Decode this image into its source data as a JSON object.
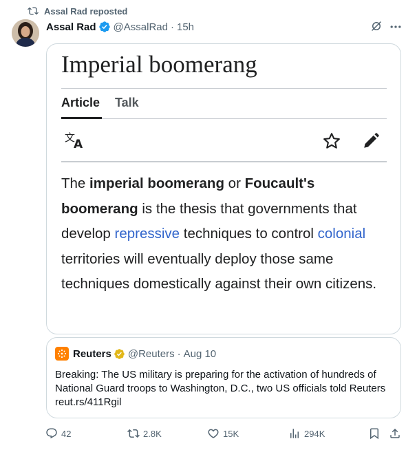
{
  "repost": {
    "label": "Assal Rad reposted"
  },
  "post": {
    "author_name": "Assal Rad",
    "handle": "@AssalRad",
    "separator": "·",
    "time": "15h"
  },
  "media": {
    "title": "Imperial boomerang",
    "tabs": [
      "Article",
      "Talk"
    ],
    "body": {
      "p1": "The ",
      "b1": "imperial boomerang",
      "p2": " or ",
      "b2": "Foucault's boomerang",
      "p3": " is the thesis that governments that develop ",
      "l1": "repressive",
      "p4": " techniques to control ",
      "l2": "colonial",
      "p5": " territories will eventually deploy those same techniques domestically against their own citizens."
    }
  },
  "quote": {
    "author_name": "Reuters",
    "handle": "@Reuters",
    "separator": "·",
    "time": "Aug 10",
    "text": "Breaking: The US military is preparing for the activation of hundreds of National Guard troops to Washington, D.C., two US officials told Reuters reut.rs/411Rgil"
  },
  "actions": {
    "replies": "42",
    "reposts": "2.8K",
    "likes": "15K",
    "views": "294K"
  },
  "icons": [
    "repost-icon",
    "verified-badge-icon",
    "grok-icon",
    "more-icon",
    "translate-icon",
    "star-icon",
    "edit-icon",
    "reuters-logo-icon",
    "gold-verified-badge-icon",
    "reply-icon",
    "like-icon",
    "views-icon",
    "bookmark-icon",
    "share-icon"
  ],
  "colors": {
    "accent": "#1d9bf0",
    "muted": "#536471",
    "wiki_link": "#3366cc",
    "reuters_orange": "#ff8000",
    "gold_badge": "#e2b719"
  }
}
